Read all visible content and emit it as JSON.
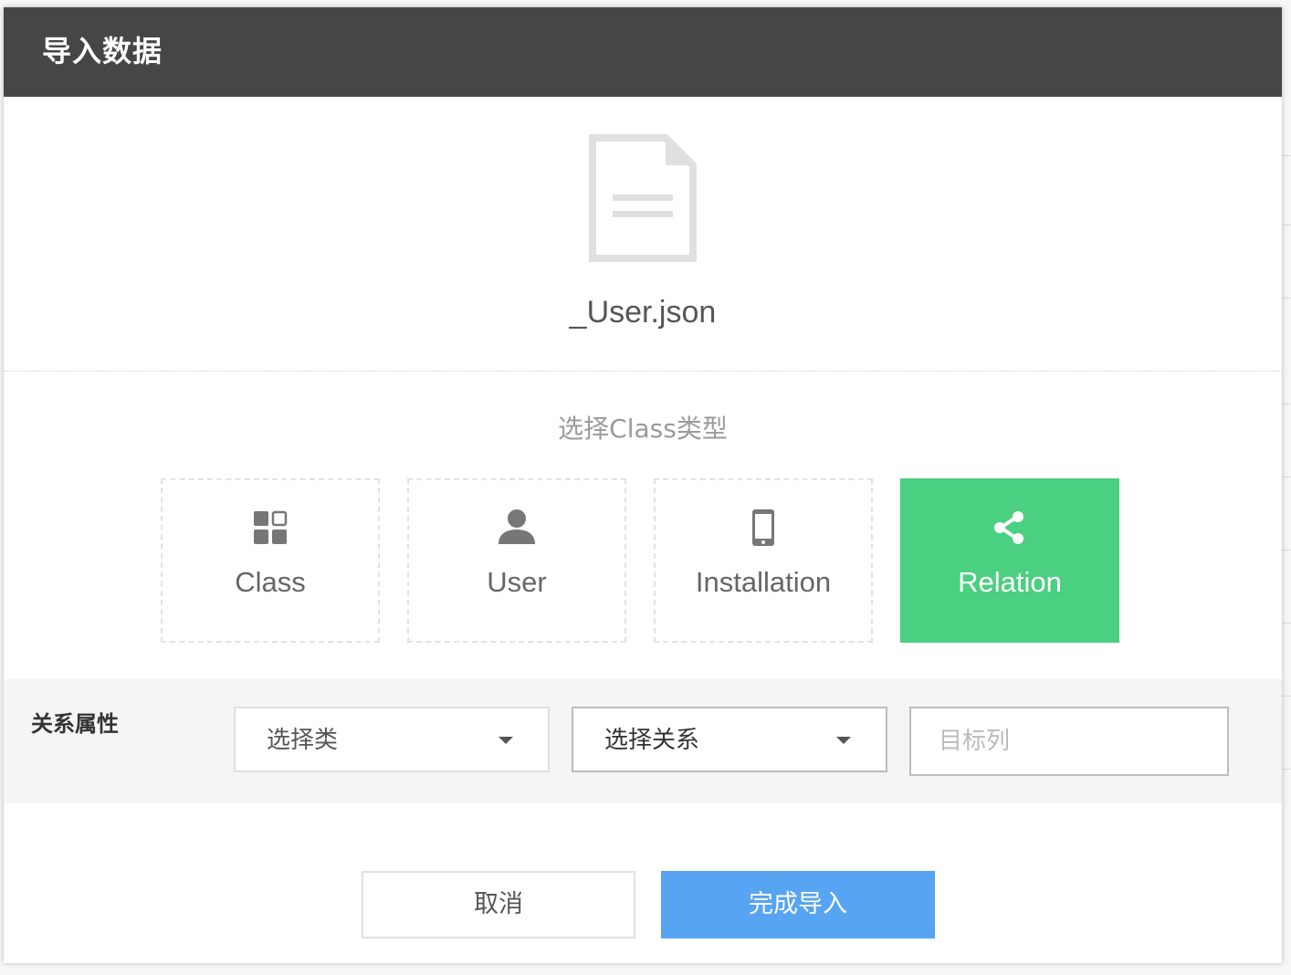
{
  "dialog": {
    "title": "导入数据",
    "file_icon": "document-icon",
    "file_name": "_User.json"
  },
  "class_type": {
    "heading": "选择Class类型",
    "selected": "Relation",
    "options": [
      {
        "label": "Class",
        "icon": "grid-icon"
      },
      {
        "label": "User",
        "icon": "user-icon"
      },
      {
        "label": "Installation",
        "icon": "mobile-icon"
      },
      {
        "label": "Relation",
        "icon": "share-icon"
      }
    ]
  },
  "relation": {
    "label": "关系属性",
    "class_select": {
      "value": "选择类"
    },
    "relation_select": {
      "value": "选择关系"
    },
    "target_column": {
      "value": "",
      "placeholder": "目标列"
    }
  },
  "actions": {
    "cancel_label": "取消",
    "confirm_label": "完成导入"
  },
  "colors": {
    "header_bg": "#464646",
    "selected_card": "#4bcf81",
    "primary_button": "#57a4f3"
  }
}
